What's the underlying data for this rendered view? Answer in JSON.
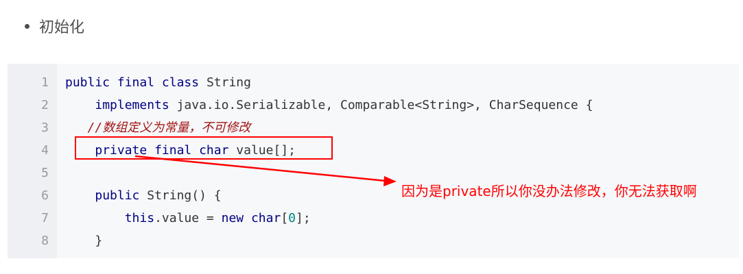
{
  "heading": {
    "bullet_text": "初始化"
  },
  "code": {
    "line_numbers": [
      "1",
      "2",
      "3",
      "4",
      "5",
      "6",
      "7",
      "8"
    ],
    "line1": {
      "kw1": "public",
      "kw2": "final",
      "kw3": "class",
      "rest": "String"
    },
    "line2": {
      "kw": "implements",
      "rest": "java.io.Serializable, Comparable<String>, CharSequence {"
    },
    "line3": {
      "comment": "//数组定义为常量，不可修改"
    },
    "line4": {
      "kw1": "private",
      "kw2": "final",
      "kw3": "char",
      "rest": "value[];"
    },
    "line6": {
      "kw": "public",
      "rest": "String() {"
    },
    "line7": {
      "kw1": "this",
      "mid": ".value = ",
      "kw2": "new",
      "kw3": "char",
      "br1": "[",
      "num": "0",
      "br2": "];"
    },
    "line8": {
      "rest": "}"
    }
  },
  "annotation": {
    "text": "因为是private所以你没办法修改，你无法获取啊",
    "color": "#ff0000"
  }
}
